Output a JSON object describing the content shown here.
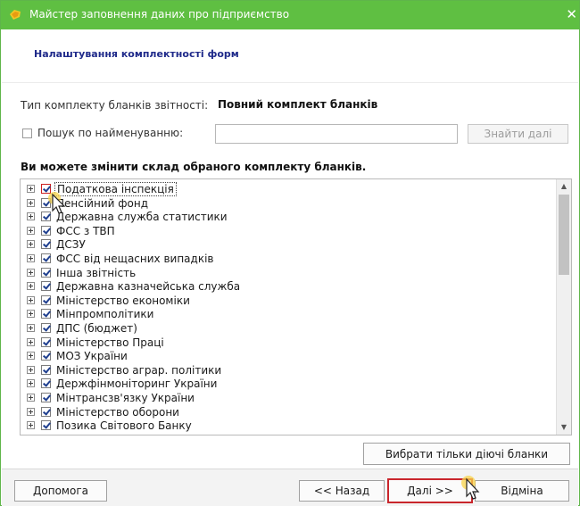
{
  "window": {
    "title": "Майстер заповнення даних про підприємство",
    "accent_color": "#5fbf42"
  },
  "header": {
    "title": "Налаштування комплектності форм"
  },
  "kit": {
    "label": "Тип комплекту бланків звітності:",
    "value": "Повний комплект бланків"
  },
  "search": {
    "checkbox_label": "Пошук по найменуванню:",
    "value": "",
    "find_next_label": "Знайти далі"
  },
  "forms": {
    "section_title": "Ви можете змінити склад обраного комплекту бланків.",
    "items": [
      {
        "label": "Податкова інспекція",
        "checked": true
      },
      {
        "label": "Пенсійний фонд",
        "checked": true
      },
      {
        "label": "Державна служба статистики",
        "checked": true
      },
      {
        "label": "ФСС з ТВП",
        "checked": true
      },
      {
        "label": "ДСЗУ",
        "checked": true
      },
      {
        "label": "ФСС від нещасних випадків",
        "checked": true
      },
      {
        "label": "Інша звітність",
        "checked": true
      },
      {
        "label": "Державна казначейська служба",
        "checked": true
      },
      {
        "label": "Міністерство економіки",
        "checked": true
      },
      {
        "label": "Мінпромполітики",
        "checked": true
      },
      {
        "label": "ДПС (бюджет)",
        "checked": true
      },
      {
        "label": "Міністерство Праці",
        "checked": true
      },
      {
        "label": "МОЗ України",
        "checked": true
      },
      {
        "label": "Міністерство аграр. політики",
        "checked": true
      },
      {
        "label": "Держфінмоніторинг України",
        "checked": true
      },
      {
        "label": "Мінтрансзв'язку України",
        "checked": true
      },
      {
        "label": "Міністерство оборони",
        "checked": true
      },
      {
        "label": "Позика Світового Банку",
        "checked": true
      }
    ],
    "select_active_label": "Вибрати тільки діючі бланки"
  },
  "footer": {
    "help_label": "Допомога",
    "back_label": "<< Назад",
    "next_label": "Далі >>",
    "cancel_label": "Відміна"
  }
}
